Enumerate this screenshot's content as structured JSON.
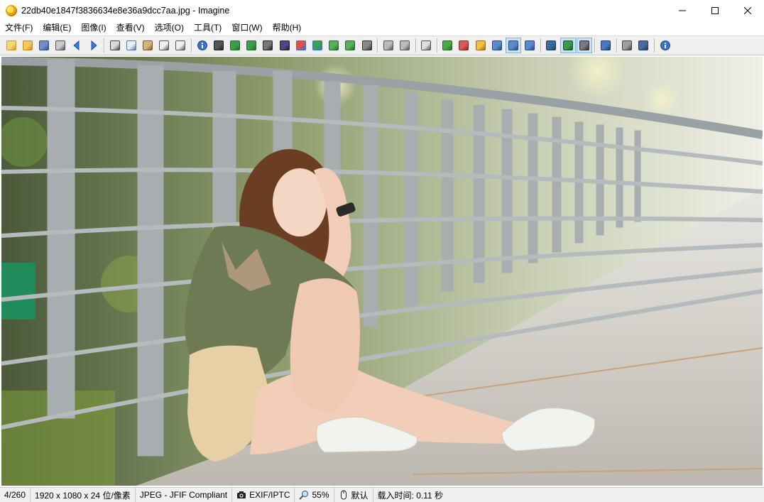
{
  "window": {
    "title": "22db40e1847f3836634e8e36a9dcc7aa.jpg - Imagine",
    "app_icon": "imagine-sunflower-icon"
  },
  "menu": {
    "items": [
      "文件(F)",
      "编辑(E)",
      "图像(I)",
      "查看(V)",
      "选项(O)",
      "工具(T)",
      "窗口(W)",
      "帮助(H)"
    ]
  },
  "toolbar": {
    "groups": [
      [
        "open-file-icon",
        "open-folder-icon",
        "save-icon",
        "print-icon",
        "previous-icon",
        "next-icon"
      ],
      [
        "cut-icon",
        "copy-icon",
        "paste-icon",
        "undo-icon",
        "redo-icon"
      ],
      [
        "info-icon",
        "capture-icon",
        "rotate-left-icon",
        "rotate-right-icon",
        "gradient-icon",
        "frame-icon",
        "color-adjust-icon",
        "effects-icon",
        "resize-icon",
        "convert-icon",
        "crop-icon"
      ],
      [
        "flip-horizontal-icon",
        "flip-vertical-icon"
      ],
      [
        "retouch-icon"
      ],
      [
        "zoom-in-icon",
        "zoom-out-icon",
        "zoom-fit-icon",
        "actual-size-icon",
        "fit-window-icon",
        "fit-width-icon"
      ],
      [
        "fullscreen-icon",
        "thumbnail-icon",
        "slideshow-icon"
      ],
      [
        "settings-wrench-icon"
      ],
      [
        "batch-convert-icon",
        "capture-screen-icon"
      ],
      [
        "help-icon"
      ]
    ],
    "active": [
      "thumbnail-icon",
      "slideshow-icon",
      "fit-window-icon"
    ]
  },
  "status": {
    "index": "4/260",
    "dimensions": "1920 x 1080 x 24 位/像素",
    "format": "JPEG - JFIF Compliant",
    "metadata": "EXIF/IPTC",
    "zoom": "55%",
    "mode": "默认",
    "load_time": "载入时间: 0.11 秒"
  },
  "colors": {
    "accent_active": "#cde3f7",
    "toolbar_bg": "#f0f0f0"
  }
}
